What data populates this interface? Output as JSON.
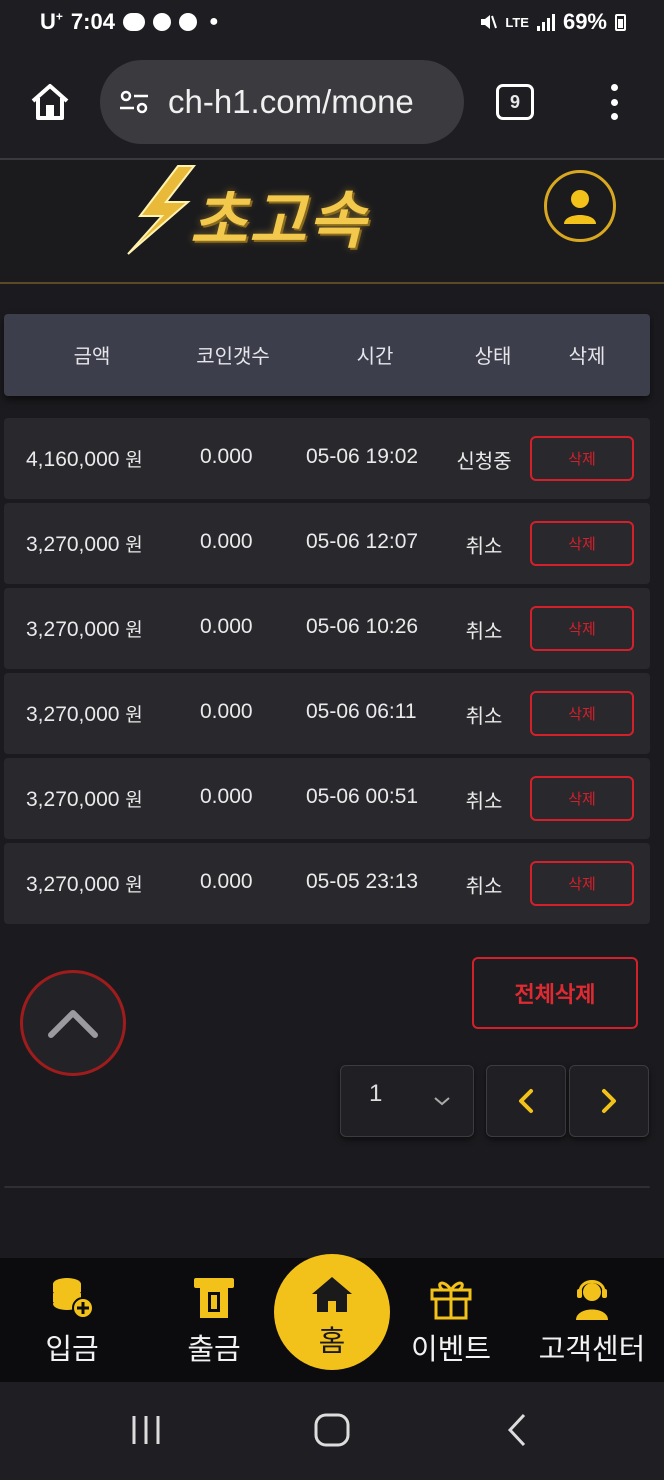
{
  "status_bar": {
    "carrier": "U",
    "carrier_sup": "+",
    "time": "7:04",
    "network": "LTE",
    "battery": "69%"
  },
  "browser": {
    "url": "ch-h1.com/mone",
    "tab_count": "9"
  },
  "site": {
    "logo_text": "초고속"
  },
  "table": {
    "headers": {
      "amount": "금액",
      "coin_count": "코인갯수",
      "time": "시간",
      "status": "상태",
      "delete": "삭제"
    },
    "rows": [
      {
        "amount": "4,160,000",
        "unit": "원",
        "coins": "0.000",
        "time": "05-06 19:02",
        "status": "신청중",
        "delete": "삭제"
      },
      {
        "amount": "3,270,000",
        "unit": "원",
        "coins": "0.000",
        "time": "05-06 12:07",
        "status": "취소",
        "delete": "삭제"
      },
      {
        "amount": "3,270,000",
        "unit": "원",
        "coins": "0.000",
        "time": "05-06 10:26",
        "status": "취소",
        "delete": "삭제"
      },
      {
        "amount": "3,270,000",
        "unit": "원",
        "coins": "0.000",
        "time": "05-06 06:11",
        "status": "취소",
        "delete": "삭제"
      },
      {
        "amount": "3,270,000",
        "unit": "원",
        "coins": "0.000",
        "time": "05-06 00:51",
        "status": "취소",
        "delete": "삭제"
      },
      {
        "amount": "3,270,000",
        "unit": "원",
        "coins": "0.000",
        "time": "05-05 23:13",
        "status": "취소",
        "delete": "삭제"
      }
    ]
  },
  "controls": {
    "delete_all": "전체삭제",
    "page": "1"
  },
  "bottom_nav": {
    "deposit": "입금",
    "withdraw": "출금",
    "home": "홈",
    "event": "이벤트",
    "support": "고객센터"
  },
  "icons": {
    "home": "home-icon",
    "tune": "site-settings-icon",
    "menu": "more-vert-icon",
    "user": "user-icon",
    "scroll_top": "chevron-up-icon",
    "chevron_down": "chevron-down-icon",
    "prev": "chevron-left-icon",
    "next": "chevron-right-icon"
  },
  "colors": {
    "accent_gold": "#f3c21a",
    "danger_red": "#d4202a",
    "header_bg": "#3d3e4c",
    "row_bg": "#28282d"
  }
}
